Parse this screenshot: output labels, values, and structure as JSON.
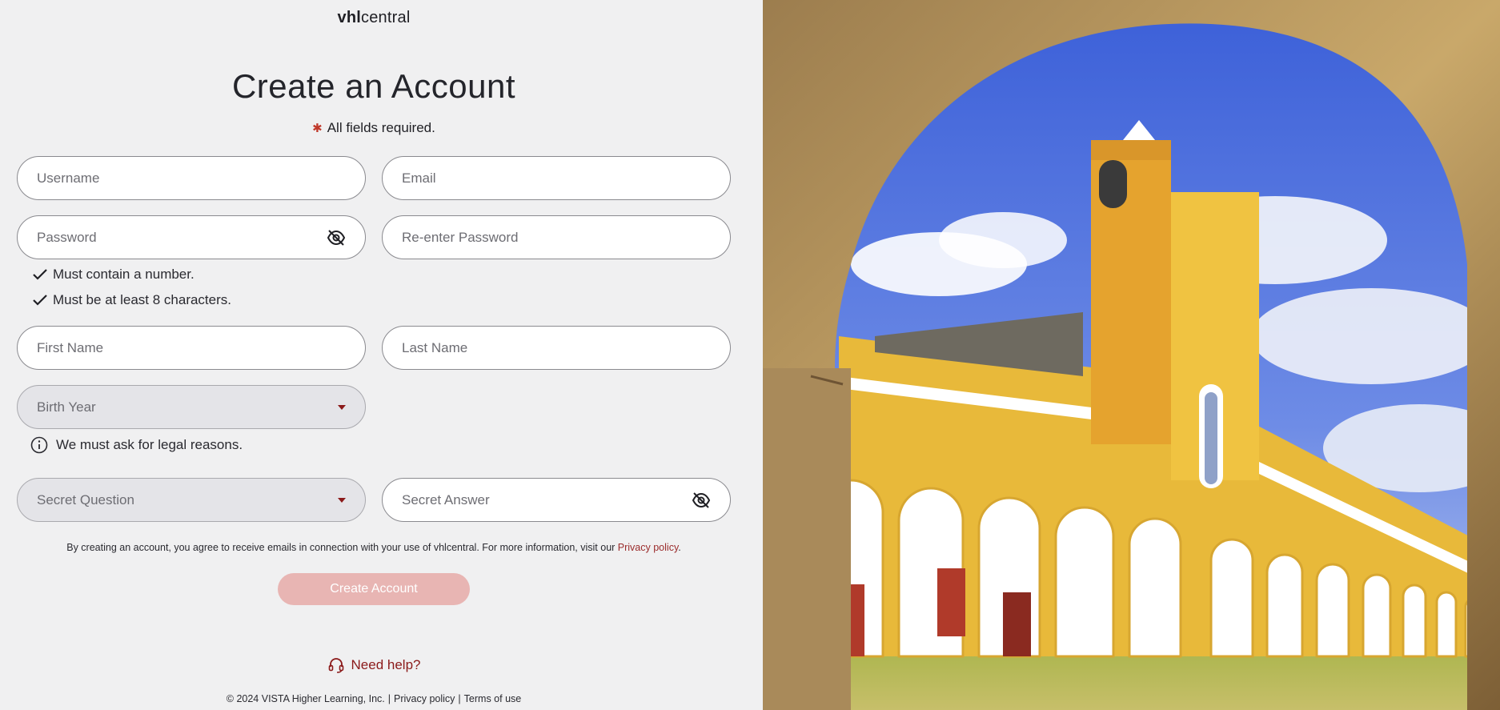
{
  "logo": {
    "bold": "vhl",
    "regular": "central"
  },
  "title": "Create an Account",
  "required_note": "All fields required.",
  "fields": {
    "username": {
      "placeholder": "Username"
    },
    "email": {
      "placeholder": "Email"
    },
    "password": {
      "placeholder": "Password"
    },
    "reenter_password": {
      "placeholder": "Re-enter Password"
    },
    "first_name": {
      "placeholder": "First Name"
    },
    "last_name": {
      "placeholder": "Last Name"
    },
    "birth_year": {
      "placeholder": "Birth Year"
    },
    "secret_question": {
      "placeholder": "Secret Question"
    },
    "secret_answer": {
      "placeholder": "Secret Answer"
    }
  },
  "password_rules": [
    {
      "text": "Must contain a number."
    },
    {
      "text": "Must be at least 8 characters."
    }
  ],
  "birth_year_info": "We must ask for legal reasons.",
  "consent": {
    "text": "By creating an account, you agree to receive emails in connection with your use of vhlcentral. For more information, visit our ",
    "link": "Privacy policy",
    "end": "."
  },
  "create_button": "Create Account",
  "help_link": "Need help?",
  "footer": {
    "copyright": "© 2024 VISTA Higher Learning, Inc.",
    "privacy": "Privacy policy",
    "terms": "Terms of use"
  },
  "colors": {
    "accent": "#8b1a1a",
    "button_disabled": "#e8b5b3",
    "background": "#f0f0f1"
  },
  "icons": [
    "eye-off-icon",
    "checkmark-icon",
    "info-icon",
    "headset-icon",
    "caret-down-icon"
  ]
}
